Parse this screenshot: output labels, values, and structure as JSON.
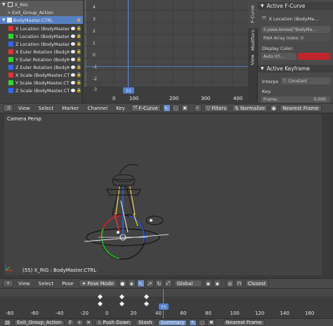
{
  "channels": {
    "rig": "X_RIG",
    "action": "Exit_Group_Action",
    "group": "BodyMaster.CTRL",
    "items": [
      {
        "label": "X Location (BodyMaster.",
        "color": "#e33333"
      },
      {
        "label": "Y Location (BodyMaster.",
        "color": "#33d433"
      },
      {
        "label": "Z Location (BodyMaster.",
        "color": "#3366ff"
      },
      {
        "label": "X Euler Rotation (BodyM",
        "color": "#e33333"
      },
      {
        "label": "Y Euler Rotation (BodyM",
        "color": "#33d433"
      },
      {
        "label": "Z Euler Rotation (BodyM",
        "color": "#3366ff"
      },
      {
        "label": "X Scale (BodyMaster.CTR",
        "color": "#e33333"
      },
      {
        "label": "Y Scale (BodyMaster.CTR",
        "color": "#33d433"
      },
      {
        "label": "Z Scale (BodyMaster.CTR",
        "color": "#3366ff"
      }
    ]
  },
  "graph": {
    "y_labels": [
      "4",
      "3",
      "2",
      "1",
      "0",
      "-1",
      "-2",
      "-3"
    ],
    "x_labels": [
      "0",
      "100",
      "200",
      "300",
      "400"
    ],
    "current_frame": "55"
  },
  "props": {
    "tabs": [
      "F-Curve",
      "Modifiers",
      "View"
    ],
    "active_fcurve_title": "Active F-Curve",
    "fcurve_name": "X Location (BodyMa...",
    "rna_path": "pose.bones[\"BodyMa...",
    "rna_index": "RNA Array Index: 0",
    "display_color_label": "Display Color:",
    "color_mode": "Auto XY...",
    "curve_color": "#c0262c",
    "active_keyframe_title": "Active Keyframe",
    "interp_label": "Interpo",
    "interp_value": "Constant",
    "key_label": "Key:",
    "frame_label": "Frame:",
    "frame_value": "0.000"
  },
  "graph_header": {
    "menus": [
      "View",
      "Select",
      "Marker",
      "Channel",
      "Key"
    ],
    "mode": "F-Curve",
    "filters": "Filters",
    "normalize": "Normalize",
    "pivot": "Nearest Frame"
  },
  "viewport": {
    "camera_label": "Camera Persp",
    "status": "(55) X_RIG : BodyMaster.CTRL"
  },
  "viewport_header": {
    "menus": [
      "View",
      "Select",
      "Pose"
    ],
    "mode": "Pose Mode",
    "orientation": "Global",
    "snap": "Closest"
  },
  "dopesheet": {
    "x_labels": [
      "-80",
      "-60",
      "-40",
      "-20",
      "0",
      "20",
      "40",
      "60",
      "80",
      "100",
      "120",
      "140",
      "160"
    ],
    "current_frame": "55"
  },
  "dope_header": {
    "action": "Exit_Group_Action",
    "push_down": "Push Down",
    "stash": "Stash",
    "summary": "Summary",
    "pivot": "Nearest Frame"
  }
}
